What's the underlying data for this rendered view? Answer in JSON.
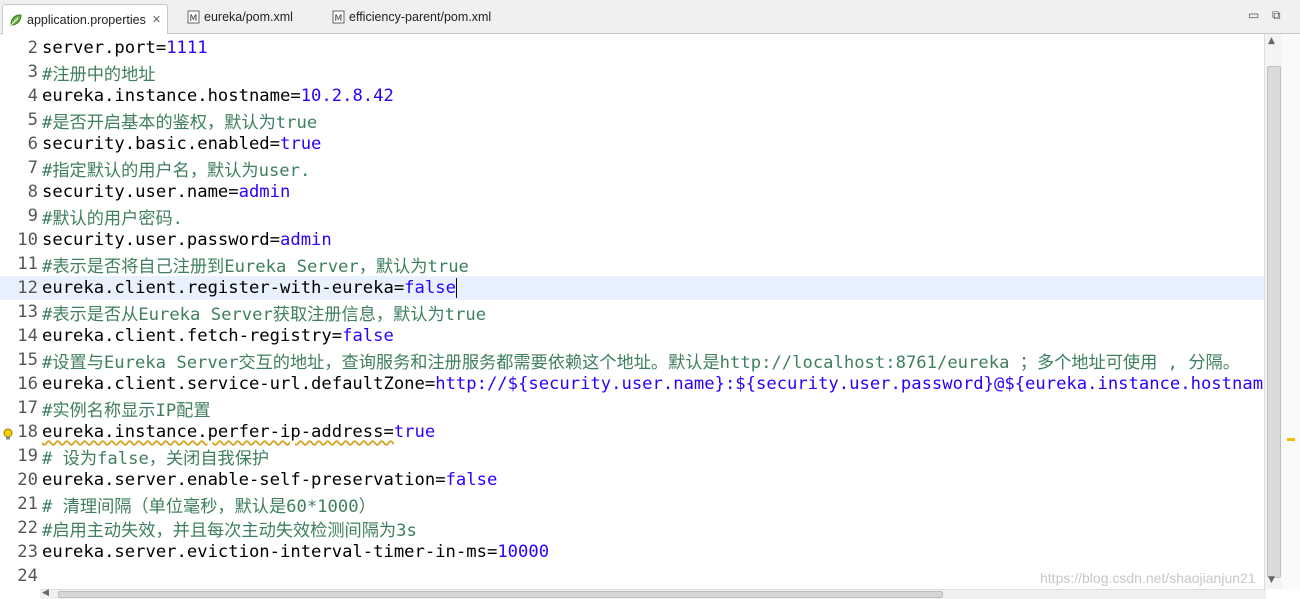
{
  "tabs": [
    {
      "label": "application.properties",
      "active": true,
      "icon": "leaf-icon"
    },
    {
      "label": "eureka/pom.xml",
      "active": false,
      "icon": "maven-file-icon"
    },
    {
      "label": "efficiency-parent/pom.xml",
      "active": false,
      "icon": "maven-file-icon"
    }
  ],
  "window_controls": {
    "minimize": "▭",
    "maximize": "⧉"
  },
  "lines": [
    {
      "n": "2",
      "key": "server.port=",
      "val": "1111"
    },
    {
      "n": "3",
      "comment": "#注册中的地址"
    },
    {
      "n": "4",
      "key": "eureka.instance.hostname=",
      "val": "10.2.8.42"
    },
    {
      "n": "5",
      "comment": "#是否开启基本的鉴权，默认为true"
    },
    {
      "n": "6",
      "key": "security.basic.enabled=",
      "val": "true"
    },
    {
      "n": "7",
      "comment": "#指定默认的用户名，默认为user."
    },
    {
      "n": "8",
      "key": "security.user.name=",
      "val": "admin"
    },
    {
      "n": "9",
      "comment": "#默认的用户密码."
    },
    {
      "n": "10",
      "key": "security.user.password=",
      "val": "admin"
    },
    {
      "n": "11",
      "comment": "#表示是否将自己注册到Eureka Server，默认为true"
    },
    {
      "n": "12",
      "key": "eureka.client.register-with-eureka=",
      "val": "false"
    },
    {
      "n": "13",
      "comment": "#表示是否从Eureka Server获取注册信息，默认为true"
    },
    {
      "n": "14",
      "key": "eureka.client.fetch-registry=",
      "val": "false"
    },
    {
      "n": "15",
      "comment": "#设置与Eureka Server交互的地址，查询服务和注册服务都需要依赖这个地址。默认是http://localhost:8761/eureka ；多个地址可使用 , 分隔。"
    },
    {
      "n": "16",
      "key": "eureka.client.service-url.defaultZone=",
      "val": "http://${security.user.name}:${security.user.password}@${eureka.instance.hostname}:${server.port}/eureka/"
    },
    {
      "n": "17",
      "comment": "#实例名称显示IP配置"
    },
    {
      "n": "18",
      "key": "eureka.instance.perfer-ip-address=",
      "val": "true"
    },
    {
      "n": "19",
      "comment": "# 设为false，关闭自我保护"
    },
    {
      "n": "20",
      "key": "eureka.server.enable-self-preservation=",
      "val": "false"
    },
    {
      "n": "21",
      "comment": "# 清理间隔（单位毫秒，默认是60*1000）"
    },
    {
      "n": "22",
      "comment": "#启用主动失效，并且每次主动失效检测间隔为3s"
    },
    {
      "n": "23",
      "key": "eureka.server.eviction-interval-timer-in-ms=",
      "val": "10000"
    },
    {
      "n": "24"
    }
  ],
  "current_line": "12",
  "warning_line": "18",
  "watermark": "https://blog.csdn.net/shaojianjun21",
  "colors": {
    "key": "#000000",
    "value": "#2a00ff",
    "comment": "#3f7f5f",
    "current_line_bg": "#e8f2fe"
  }
}
